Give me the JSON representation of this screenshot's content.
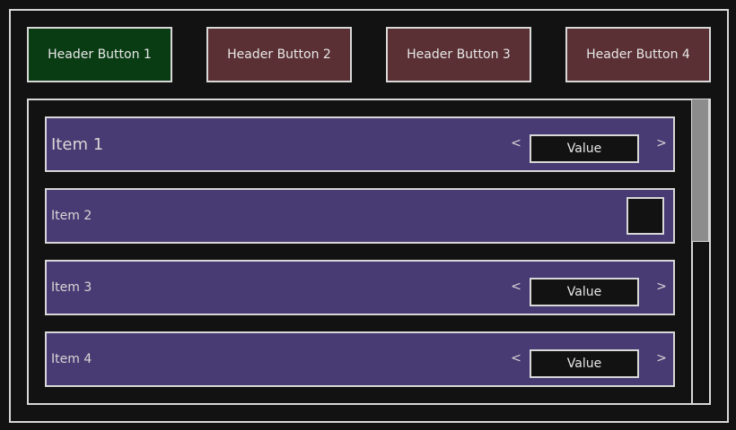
{
  "header": {
    "buttons": [
      {
        "label": "Header Button 1",
        "color": "#0a3c14",
        "state": "active"
      },
      {
        "label": "Header Button 2",
        "color": "#5a3034"
      },
      {
        "label": "Header Button 3",
        "color": "#5a3034"
      },
      {
        "label": "Header Button 4",
        "color": "#5a3034"
      }
    ]
  },
  "list": {
    "items": [
      {
        "label": "Item 1",
        "control": "stepper",
        "value": "Value",
        "prev_icon": "chevron-left-icon",
        "next_icon": "chevron-right-icon"
      },
      {
        "label": "Item 2",
        "control": "checkbox",
        "checked": false
      },
      {
        "label": "Item 3",
        "control": "stepper",
        "value": "Value",
        "prev_icon": "chevron-left-icon",
        "next_icon": "chevron-right-icon"
      },
      {
        "label": "Item 4",
        "control": "stepper",
        "value": "Value",
        "prev_icon": "chevron-left-icon",
        "next_icon": "chevron-right-icon"
      }
    ],
    "arrow_left_glyph": "<",
    "arrow_right_glyph": ">"
  },
  "colors": {
    "background": "#121212",
    "row_fill": "#483a72",
    "border": "#d8d8d8",
    "active_button": "#0a3c14",
    "inactive_button": "#5a3034",
    "scrollbar_thumb": "#8c8c8c"
  },
  "scrollbar": {
    "visible_fraction": 0.47
  }
}
